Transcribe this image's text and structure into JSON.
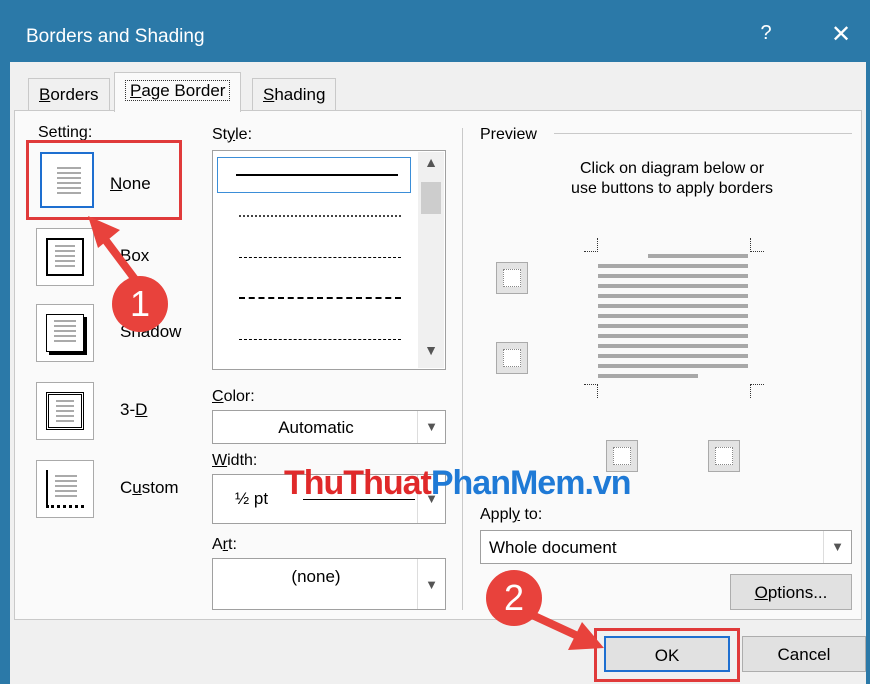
{
  "window": {
    "title": "Borders and Shading",
    "help_label": "?",
    "close_label": "✕"
  },
  "tabs": [
    {
      "label": "Borders",
      "underline": "B",
      "rest": "orders"
    },
    {
      "label": "Page Border",
      "underline": "P",
      "rest": "age Border"
    },
    {
      "label": "Shading",
      "underline": "S",
      "rest": "hading"
    }
  ],
  "setting": {
    "label": "Setting:",
    "items": [
      {
        "pre": "",
        "u": "N",
        "post": "one"
      },
      {
        "pre": "",
        "u": "",
        "post": "Box"
      },
      {
        "pre": "Sh",
        "u": "",
        "post": "adow"
      },
      {
        "pre": "3-",
        "u": "D",
        "post": ""
      },
      {
        "pre": "C",
        "u": "u",
        "post": "stom"
      }
    ]
  },
  "style": {
    "pre": "St",
    "u": "y",
    "post": "le:"
  },
  "color": {
    "pre": "",
    "u": "C",
    "post": "olor:",
    "value": "Automatic"
  },
  "width": {
    "pre": "",
    "u": "W",
    "post": "idth:",
    "value": "½ pt"
  },
  "art": {
    "pre": "A",
    "u": "r",
    "post": "t:",
    "value": "(none)"
  },
  "preview": {
    "label": "Preview",
    "hint_line1": "Click on diagram below or",
    "hint_line2": "use buttons to apply borders"
  },
  "apply_to": {
    "pre": "Appl",
    "u": "y",
    "post": " to:",
    "value": "Whole document"
  },
  "buttons": {
    "options": {
      "u": "O",
      "post": "ptions..."
    },
    "ok": "OK",
    "cancel": "Cancel"
  },
  "annotations": {
    "badge1": "1",
    "badge2": "2",
    "accent": "#e03a3a"
  },
  "watermark": {
    "part1": "ThuThuat",
    "part2": "PhanMem",
    "part3": ".vn"
  },
  "colors": {
    "titlebar": "#2b79a8",
    "selection": "#1e6fd0",
    "annotation": "#e8423c"
  }
}
